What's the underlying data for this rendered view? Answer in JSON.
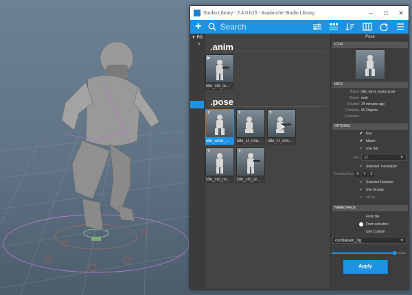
{
  "window": {
    "title": "Studio Library - 2.4.0.b15 - Avalanche Studio Library"
  },
  "toolbar": {
    "add": "+",
    "search_placeholder": "Search"
  },
  "folders": {
    "header": "FO"
  },
  "library": {
    "groups": [
      ".anim",
      ".pose"
    ],
    "anim_items": [
      {
        "label": "idle_std_ai..."
      }
    ],
    "pose_items": [
      {
        "label": "idle_wind_...",
        "selected": true
      },
      {
        "label": "idle_cr_noa..."
      },
      {
        "label": "idle_cr_aim..."
      },
      {
        "label": "idle_std_no..."
      },
      {
        "label": "idle_std_ai..."
      }
    ]
  },
  "panel": {
    "title": "Pose",
    "icon_section": "ICON",
    "info_section": "INFO",
    "info": [
      {
        "key": "Name",
        "value": "idle_wind_noaim.pose"
      },
      {
        "key": "Owner",
        "value": "endr"
      },
      {
        "key": "Created",
        "value": "14 minutes ago"
      },
      {
        "key": "Contains",
        "value": "90 Objects"
      },
      {
        "key": "Comment",
        "value": ""
      }
    ],
    "options_section": "OPTIONS",
    "options": {
      "key": "Key",
      "match": "Match",
      "use_set": "Use Set",
      "set_label": "Set",
      "set_value": "all",
      "selected_translation": "Selected Translation",
      "enabled_axis": "Enabled Axis",
      "axis_x": "X",
      "axis_y": "Y",
      "axis_z": "Z",
      "selected_rotation": "Selected Rotation",
      "use_gravity": "Use Gravity",
      "mirror": "Mirror"
    },
    "namespace_section": "NAMESPACE",
    "namespace": {
      "from_file": "From file",
      "from_selection": "From selection",
      "use_custom": "Use Custom",
      "value": "combatant_rig"
    },
    "slider_value": 0.85,
    "apply": "Apply"
  }
}
